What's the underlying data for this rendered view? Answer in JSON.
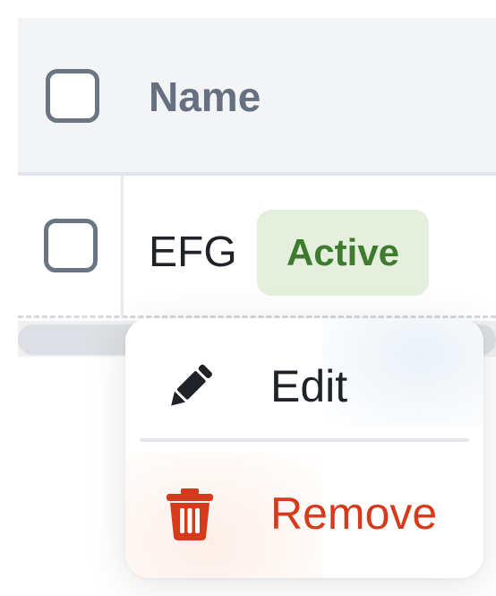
{
  "table": {
    "header": {
      "name_label": "Name"
    },
    "rows": [
      {
        "name": "EFG",
        "status": "Active"
      }
    ]
  },
  "context_menu": {
    "items": [
      {
        "label": "Edit",
        "icon": "pencil-icon"
      },
      {
        "label": "Remove",
        "icon": "trash-icon"
      }
    ]
  },
  "colors": {
    "badge_bg": "#e4efdd",
    "badge_text": "#3f7b2e",
    "danger": "#d63a1c",
    "header_text": "#667080"
  }
}
